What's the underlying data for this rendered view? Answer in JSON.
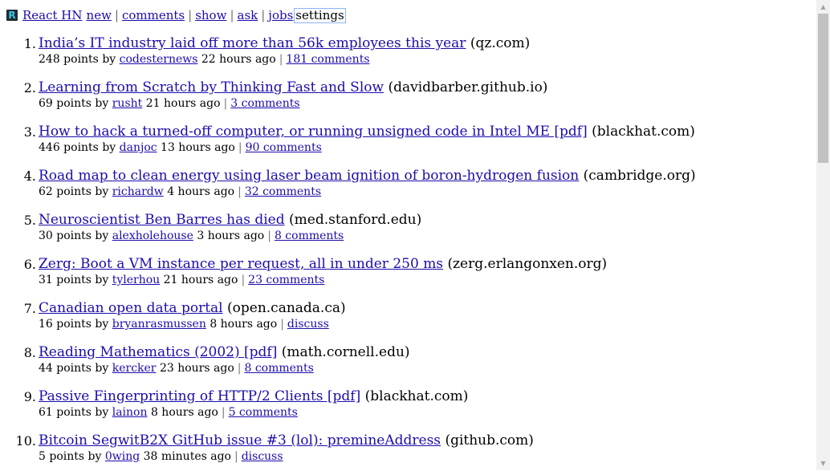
{
  "header": {
    "logo_letter": "R",
    "brand": "React HN",
    "links": {
      "new": "new",
      "comments": "comments",
      "show": "show",
      "ask": "ask",
      "jobs": "jobs",
      "settings": "settings"
    }
  },
  "stories": [
    {
      "rank": "1.",
      "title": "India’s IT industry laid off more than 56k employees this year",
      "domain": "(qz.com)",
      "points": "248 points by",
      "user": "codesternews",
      "age": "22 hours ago",
      "comments": "181 comments"
    },
    {
      "rank": "2.",
      "title": "Learning from Scratch by Thinking Fast and Slow",
      "domain": "(davidbarber.github.io)",
      "points": "69 points by",
      "user": "rusht",
      "age": "21 hours ago",
      "comments": "3 comments"
    },
    {
      "rank": "3.",
      "title": "How to hack a turned-off computer, or running unsigned code in Intel ME [pdf]",
      "domain": "(blackhat.com)",
      "points": "446 points by",
      "user": "danjoc",
      "age": "13 hours ago",
      "comments": "90 comments"
    },
    {
      "rank": "4.",
      "title": "Road map to clean energy using laser beam ignition of boron-hydrogen fusion",
      "domain": "(cambridge.org)",
      "points": "62 points by",
      "user": "richardw",
      "age": "4 hours ago",
      "comments": "32 comments"
    },
    {
      "rank": "5.",
      "title": "Neuroscientist Ben Barres has died",
      "domain": "(med.stanford.edu)",
      "points": "30 points by",
      "user": "alexholehouse",
      "age": "3 hours ago",
      "comments": "8 comments"
    },
    {
      "rank": "6.",
      "title": "Zerg: Boot a VM instance per request, all in under 250 ms",
      "domain": "(zerg.erlangonxen.org)",
      "points": "31 points by",
      "user": "tylerhou",
      "age": "21 hours ago",
      "comments": "23 comments"
    },
    {
      "rank": "7.",
      "title": "Canadian open data portal",
      "domain": "(open.canada.ca)",
      "points": "16 points by",
      "user": "bryanrasmussen",
      "age": "8 hours ago",
      "comments": "discuss"
    },
    {
      "rank": "8.",
      "title": "Reading Mathematics (2002) [pdf]",
      "domain": "(math.cornell.edu)",
      "points": "44 points by",
      "user": "kercker",
      "age": "23 hours ago",
      "comments": "8 comments"
    },
    {
      "rank": "9.",
      "title": "Passive Fingerprinting of HTTP/2 Clients [pdf]",
      "domain": "(blackhat.com)",
      "points": "61 points by",
      "user": "lainon",
      "age": "8 hours ago",
      "comments": "5 comments"
    },
    {
      "rank": "10.",
      "title": "Bitcoin SegwitB2X GitHub issue #3 (lol): premineAddress",
      "domain": "(github.com)",
      "points": "5 points by",
      "user": "0wing",
      "age": "38 minutes ago",
      "comments": "discuss"
    }
  ],
  "scrollbar": {
    "up_icon": "triangle-up",
    "down_icon": "triangle-down",
    "scroll_fraction": 0.0
  }
}
